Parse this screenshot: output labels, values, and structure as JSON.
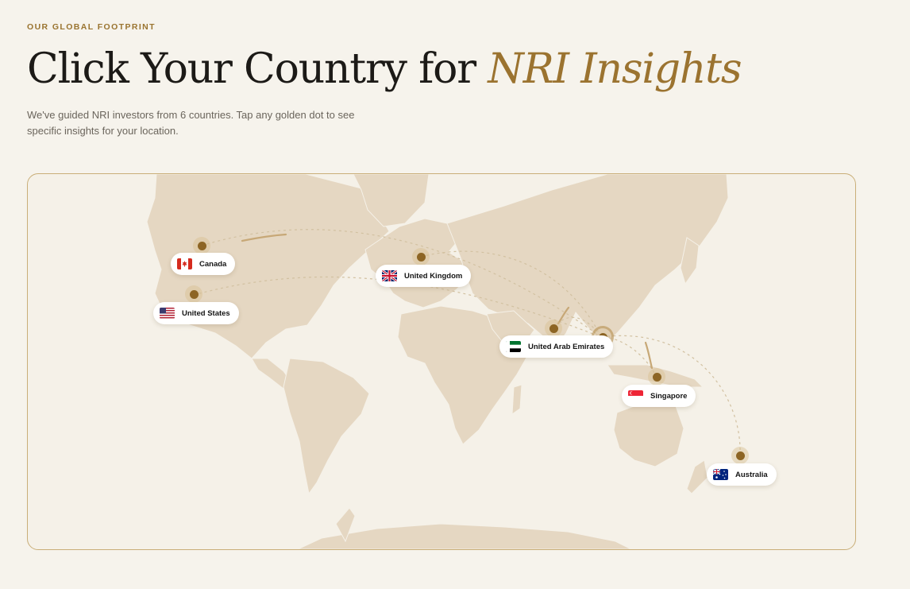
{
  "header": {
    "eyebrow": "OUR GLOBAL FOOTPRINT",
    "title_main": "Click Your Country for ",
    "title_accent": "NRI Insights",
    "subtitle": "We've guided NRI investors from 6 countries. Tap any golden dot to see specific insights for your location."
  },
  "colors": {
    "background": "#f6f3ec",
    "accent_gold": "#9b7330",
    "land": "#e5d7c2",
    "pin": "#8d6524"
  },
  "map": {
    "countries": [
      {
        "id": "canada",
        "label": "Canada",
        "flag": "canada-flag-icon"
      },
      {
        "id": "united-states",
        "label": "United States",
        "flag": "usa-flag-icon"
      },
      {
        "id": "united-kingdom",
        "label": "United Kingdom",
        "flag": "uk-flag-icon"
      },
      {
        "id": "uae",
        "label": "United Arab Emirates",
        "flag": "uae-flag-icon"
      },
      {
        "id": "singapore",
        "label": "Singapore",
        "flag": "singapore-flag-icon"
      },
      {
        "id": "australia",
        "label": "Australia",
        "flag": "australia-flag-icon"
      }
    ],
    "hub": "india-hub-marker"
  }
}
